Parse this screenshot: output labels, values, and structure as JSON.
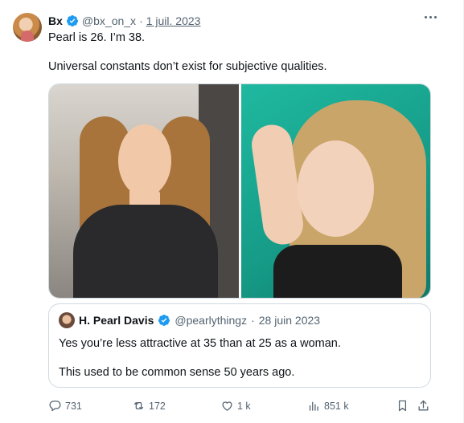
{
  "tweet": {
    "author_name": "Bx",
    "handle": "@bx_on_x",
    "separator": "·",
    "date": "1 juil. 2023",
    "line1": "Pearl is 26. I’m 38.",
    "line2": "Universal constants don’t exist for subjective qualities."
  },
  "quoted": {
    "author_name": "H. Pearl Davis",
    "handle": "@pearlythingz",
    "separator": "·",
    "date": "28 juin 2023",
    "line1": "Yes you’re less attractive at 35 than at 25 as a woman.",
    "line2": "This used to be common sense 50 years ago."
  },
  "actions": {
    "replies": "731",
    "reposts": "172",
    "likes": "1 k",
    "views": "851 k"
  },
  "icons": {
    "verified": "verified-badge-icon",
    "more": "more-icon",
    "reply": "reply-icon",
    "repost": "repost-icon",
    "like": "heart-icon",
    "views": "views-chart-icon",
    "bookmark": "bookmark-icon",
    "share": "share-icon"
  },
  "colors": {
    "verified": "#1d9bf0",
    "secondary_text": "#536471",
    "border": "#cfd9de"
  }
}
